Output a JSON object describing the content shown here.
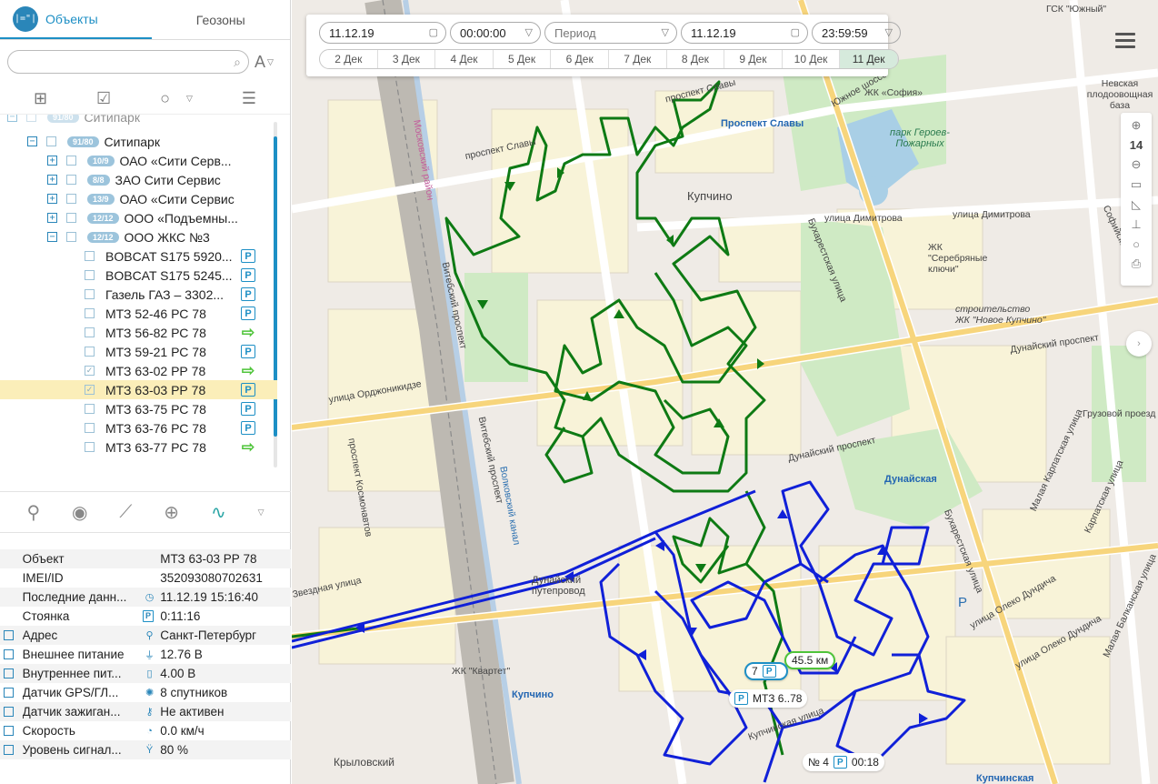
{
  "tabs": {
    "objects": "Объекты",
    "geozones": "Геозоны",
    "logo": "|=\"|"
  },
  "search": {
    "placeholder": "",
    "sort_label": "A"
  },
  "tree": [
    {
      "type": "group",
      "badge": "91/80",
      "label": "Ситипарк",
      "indent": 0,
      "expander": "−",
      "partial": true
    },
    {
      "type": "group",
      "badge": "91/80",
      "label": "Ситипарк",
      "indent": 1,
      "expander": "−"
    },
    {
      "type": "group",
      "badge": "10/9",
      "label": "ОАО «Сити Серв...",
      "indent": 2,
      "expander": "+"
    },
    {
      "type": "group",
      "badge": "8/8",
      "label": "ЗАО Сити Сервис",
      "indent": 2,
      "expander": "+"
    },
    {
      "type": "group",
      "badge": "13/9",
      "label": "ОАО «Сити Сервис",
      "indent": 2,
      "expander": "+"
    },
    {
      "type": "group",
      "badge": "12/12",
      "label": "ООО «Подъемны...",
      "indent": 2,
      "expander": "+"
    },
    {
      "type": "group",
      "badge": "12/12",
      "label": "ООО ЖКС №3",
      "indent": 2,
      "expander": "−"
    },
    {
      "type": "item",
      "label": "BOBCAT S175 5920...",
      "status": "park",
      "checked": false
    },
    {
      "type": "item",
      "label": "BOBCAT S175 5245...",
      "status": "park",
      "checked": false
    },
    {
      "type": "item",
      "label": "Газель ГАЗ – 3302...",
      "status": "park",
      "checked": false
    },
    {
      "type": "item",
      "label": "МТЗ 52-46 РС 78",
      "status": "park",
      "checked": false
    },
    {
      "type": "item",
      "label": "МТЗ 56-82 РС 78",
      "status": "move",
      "checked": false
    },
    {
      "type": "item",
      "label": "МТЗ 59-21 РС 78",
      "status": "park",
      "checked": false
    },
    {
      "type": "item",
      "label": "МТЗ 63-02 РР 78",
      "status": "move",
      "checked": true
    },
    {
      "type": "item",
      "label": "МТЗ 63-03 РР 78",
      "status": "park",
      "checked": true,
      "selected": true
    },
    {
      "type": "item",
      "label": "МТЗ 63-75 РС 78",
      "status": "park",
      "checked": false
    },
    {
      "type": "item",
      "label": "МТЗ 63-76 РС 78",
      "status": "park",
      "checked": false
    },
    {
      "type": "item",
      "label": "МТЗ 63-77 РС 78",
      "status": "move",
      "checked": false
    }
  ],
  "properties": [
    {
      "key": "Объект",
      "icon": "",
      "value": "МТЗ 63-03 РР 78",
      "checkbox": false
    },
    {
      "key": "IMEI/ID",
      "icon": "",
      "value": "352093080702631",
      "checkbox": false
    },
    {
      "key": "Последние данн...",
      "icon": "◷",
      "value": "11.12.19 15:16:40",
      "checkbox": false
    },
    {
      "key": "Стоянка",
      "icon": "P",
      "value": "0:11:16",
      "checkbox": false
    },
    {
      "key": "Адрес",
      "icon": "⚲",
      "value": "Санкт-Петербург",
      "checkbox": true
    },
    {
      "key": "Внешнее питание",
      "icon": "⏚",
      "value": "12.76 В",
      "checkbox": true
    },
    {
      "key": "Внутреннее пит...",
      "icon": "▯",
      "value": "4.00 В",
      "checkbox": true
    },
    {
      "key": "Датчик GPS/ГЛ...",
      "icon": "✺",
      "value": "8 спутников",
      "checkbox": true
    },
    {
      "key": "Датчик зажиган...",
      "icon": "⚷",
      "value": "Не активен",
      "checkbox": true
    },
    {
      "key": "Скорость",
      "icon": "◔",
      "value": "0.0 км/ч",
      "checkbox": true
    },
    {
      "key": "Уровень сигнал...",
      "icon": "Ϋ",
      "value": "80 %",
      "checkbox": true
    }
  ],
  "dates": {
    "from_date": "11.12.19",
    "from_time": "00:00:00",
    "period": "Период",
    "to_date": "11.12.19",
    "to_time": "23:59:59",
    "days": [
      "2 Дек",
      "3 Дек",
      "4 Дек",
      "5 Дек",
      "6 Дек",
      "7 Дек",
      "8 Дек",
      "9 Дек",
      "10 Дек",
      "11 Дек"
    ],
    "active_day": "11 Дек"
  },
  "zoom": {
    "level": "14"
  },
  "map_tags": {
    "distance": "45.5 км",
    "count": "7",
    "vehicle": "МТЗ 6..78",
    "stop_num": "№ 4",
    "stop_time": "00:18"
  },
  "map_labels": {
    "kupchino": "Купчино",
    "prospekt_slavy_metro": "Проспект Славы",
    "park": "парк Героев-Пожарных",
    "nevskaya": "Невская плодоовощная база",
    "ul_dimitrova": "улица Димитрова",
    "ul_dimitrova2": "улица Димитрова",
    "dunayskaya": "Дунайская",
    "dunaysky_pr": "Дунайский проспект",
    "dunaysky_pr2": "Дунайский проспект",
    "vitebsky": "Витебский проспект",
    "vitebsky2": "Витебский проспект",
    "moskovsky": "Московский район",
    "pr_slavy": "проспект Славы",
    "pr_slavy2": "проспект Славы",
    "ordzhonikidze": "улица Орджоникидзе",
    "buharestskaya": "Бухарестская улица",
    "buharestskaya2": "Бухарестская улица",
    "zvezdnaya": "Звездная улица",
    "kupchino_st": "Купчино",
    "krylovsky": "Крыловский",
    "kupchinskaya": "Купчинская",
    "gruzovoy": "Грузовой проезд",
    "sofia": "ЖК «София»",
    "serebryanye": "ЖК \"Серебряные ключи\"",
    "novoe_kupchino": "строительство ЖК \"Новое Купчино\"",
    "kvartet": "ЖК \"Квартет\"",
    "gsk": "ГСК \"Южный\"",
    "sofiyskaya": "Софийская улица",
    "malaya_karpat": "Малая Карпатская улица",
    "karpatskaya": "Карпатская улица",
    "dundicha": "улица Олеко Дундича",
    "malaya_balkan": "Малая Балканская улица",
    "volkovsky": "Волковский канал",
    "kosmonavtov": "проспект Космонавтов",
    "putoprovod": "Дунайский путепровод",
    "yuzhnoe": "Южное шоссе",
    "kupchinsky_ul": "Купчинская улица",
    "olkodund": "улица Олеко Дундича",
    "p_sign": "P"
  },
  "colors": {
    "accent": "#1d8fc5",
    "track_green": "#0e7a14",
    "track_blue": "#1020d8",
    "selected_row": "#fbeeb9"
  }
}
